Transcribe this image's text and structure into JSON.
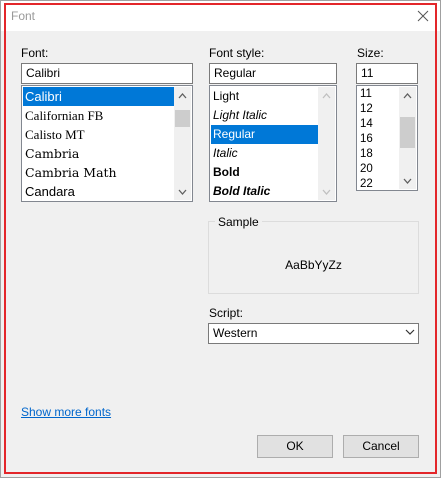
{
  "window": {
    "title": "Font"
  },
  "font": {
    "label": "Font:",
    "value": "Calibri",
    "items": [
      "Calibri",
      "Californian FB",
      "Calisto MT",
      "Cambria",
      "Cambria Math",
      "Candara"
    ],
    "selected_index": 0
  },
  "style": {
    "label": "Font style:",
    "value": "Regular",
    "items": [
      "Light",
      "Light Italic",
      "Regular",
      "Italic",
      "Bold",
      "Bold Italic"
    ],
    "selected_index": 2
  },
  "size": {
    "label": "Size:",
    "value": "11",
    "items": [
      "11",
      "12",
      "14",
      "16",
      "18",
      "20",
      "22"
    ],
    "selected_index": 0
  },
  "sample": {
    "label": "Sample",
    "text": "AaBbYyZz"
  },
  "script": {
    "label": "Script:",
    "value": "Western"
  },
  "links": {
    "show_more": "Show more fonts"
  },
  "buttons": {
    "ok": "OK",
    "cancel": "Cancel"
  },
  "colors": {
    "selection": "#0078d7",
    "link": "#0066cc",
    "highlight_border": "#e3262a"
  },
  "icons": [
    "close-icon",
    "chevron-up-icon",
    "chevron-down-icon"
  ]
}
